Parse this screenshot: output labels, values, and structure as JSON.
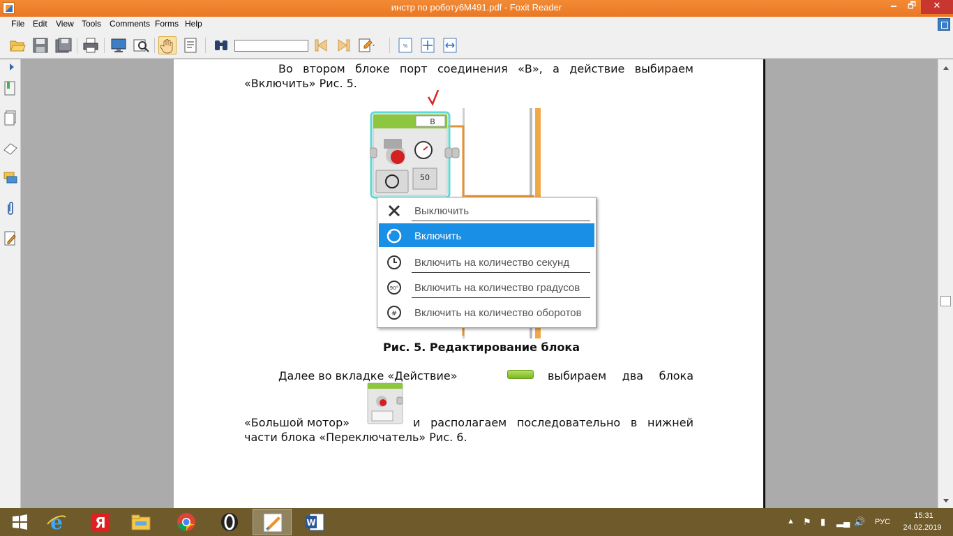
{
  "window": {
    "title": "инстр по роботу6М491.pdf - Foxit Reader",
    "min_label": "🗕",
    "max_label": "🗗",
    "close_label": "✕"
  },
  "menu": [
    "File",
    "Edit",
    "View",
    "Tools",
    "Comments",
    "Forms",
    "Help"
  ],
  "toolbar": {
    "find_value": "",
    "icons": [
      "open-icon",
      "save-icon",
      "save-as-icon",
      "print-icon",
      "monitor-icon",
      "zoom-glass-icon",
      "hand-tool-icon",
      "select-text-icon",
      "find-binoculars-icon",
      "find-prev-icon",
      "find-next-icon",
      "markup-icon",
      "actual-size-icon",
      "fit-page-icon",
      "fit-width-icon"
    ]
  },
  "sidebar": [
    "bookmarks-icon",
    "pages-icon",
    "layers-icon",
    "comments-icon",
    "attachments-icon",
    "signature-icon"
  ],
  "document": {
    "para1_line1": "Во втором блоке порт соединения «В», а действие выбираем",
    "para1_line2": "«Включить» Рис. 5.",
    "figure": {
      "port_label": "B",
      "power_value": "50",
      "menu_items": [
        {
          "label": "Выключить",
          "icon": "x-icon",
          "selected": false
        },
        {
          "label": "Включить",
          "icon": "rotate-icon",
          "selected": true
        },
        {
          "label": "Включить на количество секунд",
          "icon": "timer-icon",
          "selected": false
        },
        {
          "label": "Включить на количество градусов",
          "icon": "degrees-icon",
          "selected": false
        },
        {
          "label": "Включить на количество оборотов",
          "icon": "rotations-icon",
          "selected": false
        }
      ]
    },
    "caption": "Рис. 5. Редактирование блока",
    "para2_line1": "Далее во вкладке «Действие»",
    "para2_line1b": "выбираем два блока",
    "para2_line2a": "«Большой мотор»",
    "para2_line2b": "и располагаем последовательно в нижней",
    "para2_line3": "части блока «Переключатель» Рис. 6."
  },
  "taskbar": {
    "apps": [
      "start-icon",
      "ie-icon",
      "yandex-icon",
      "explorer-icon",
      "chrome-icon",
      "opera-icon",
      "foxit-icon",
      "word-icon"
    ],
    "active": "foxit-icon",
    "lang": "РУС",
    "time": "15:31",
    "date": "24.02.2019"
  },
  "colors": {
    "titlebar": "#ef8230",
    "selection": "#1a8fe6",
    "taskbar": "#6e5a2a",
    "ev3_green": "#8dc63f"
  }
}
